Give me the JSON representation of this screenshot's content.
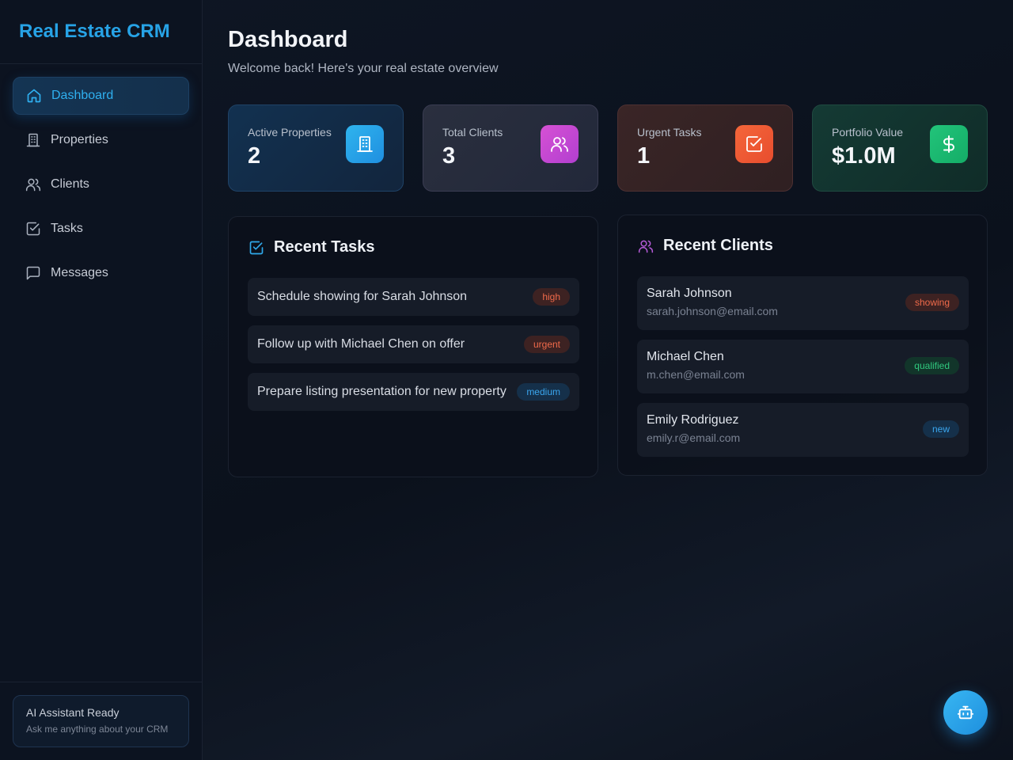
{
  "app": {
    "title": "Real Estate CRM"
  },
  "sidebar": {
    "items": [
      {
        "label": "Dashboard",
        "icon": "home-icon",
        "active": true
      },
      {
        "label": "Properties",
        "icon": "building-icon",
        "active": false
      },
      {
        "label": "Clients",
        "icon": "users-icon",
        "active": false
      },
      {
        "label": "Tasks",
        "icon": "check-square-icon",
        "active": false
      },
      {
        "label": "Messages",
        "icon": "message-icon",
        "active": false
      }
    ],
    "assistant": {
      "title": "AI Assistant Ready",
      "subtitle": "Ask me anything about your CRM"
    }
  },
  "header": {
    "title": "Dashboard",
    "subtitle": "Welcome back! Here's your real estate overview"
  },
  "stats": [
    {
      "label": "Active Properties",
      "value": "2",
      "icon": "building-icon",
      "color": "#27a3e6"
    },
    {
      "label": "Total Clients",
      "value": "3",
      "icon": "users-icon",
      "color": "#c84ad2"
    },
    {
      "label": "Urgent Tasks",
      "value": "1",
      "icon": "check-square-icon",
      "color": "#ef5a34"
    },
    {
      "label": "Portfolio Value",
      "value": "$1.0M",
      "icon": "dollar-icon",
      "color": "#1db872"
    }
  ],
  "recent_tasks": {
    "title": "Recent Tasks",
    "items": [
      {
        "text": "Schedule showing for Sarah Johnson",
        "priority": "high"
      },
      {
        "text": "Follow up with Michael Chen on offer",
        "priority": "urgent"
      },
      {
        "text": "Prepare listing presentation for new property",
        "priority": "medium"
      }
    ]
  },
  "recent_clients": {
    "title": "Recent Clients",
    "items": [
      {
        "name": "Sarah Johnson",
        "email": "sarah.johnson@email.com",
        "status": "showing"
      },
      {
        "name": "Michael Chen",
        "email": "m.chen@email.com",
        "status": "qualified"
      },
      {
        "name": "Emily Rodriguez",
        "email": "emily.r@email.com",
        "status": "new"
      }
    ]
  },
  "fab": {
    "icon": "bot-icon"
  }
}
